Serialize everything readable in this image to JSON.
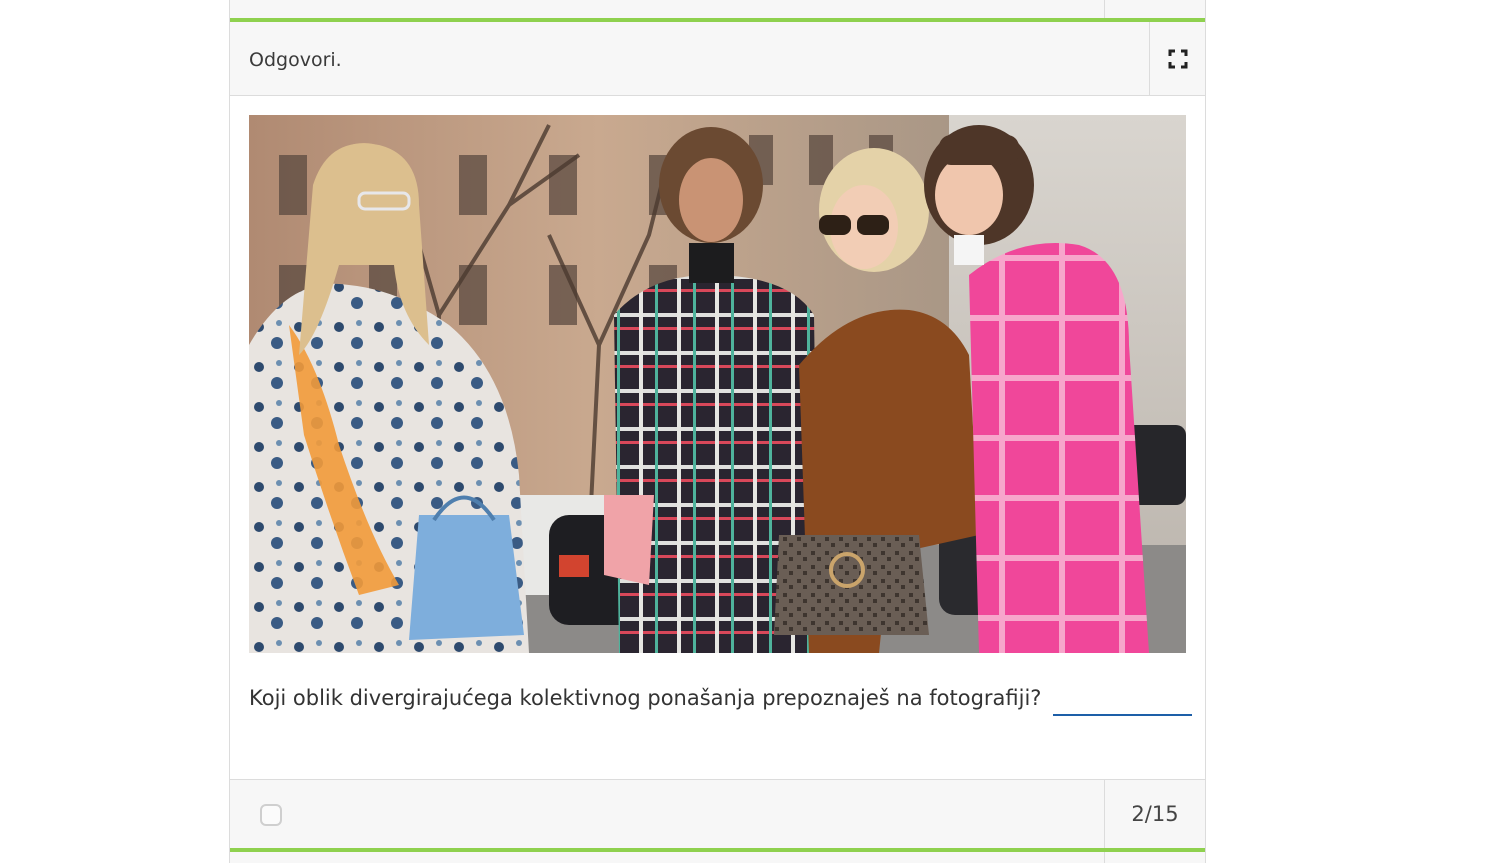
{
  "header": {
    "instruction": "Odgovori.",
    "expand_icon": "expand-fullscreen-icon"
  },
  "question": {
    "text": "Koji oblik divergirajućega kolektivnog ponašanja prepoznaješ na fotografiji?",
    "answer_value": ""
  },
  "footer": {
    "checkbox_checked": false,
    "page_counter": "2/15"
  },
  "colors": {
    "accent": "#8fd14f",
    "input_underline": "#1d5fa8",
    "panel_bg": "#f7f7f7",
    "border": "#dcdcdc"
  }
}
